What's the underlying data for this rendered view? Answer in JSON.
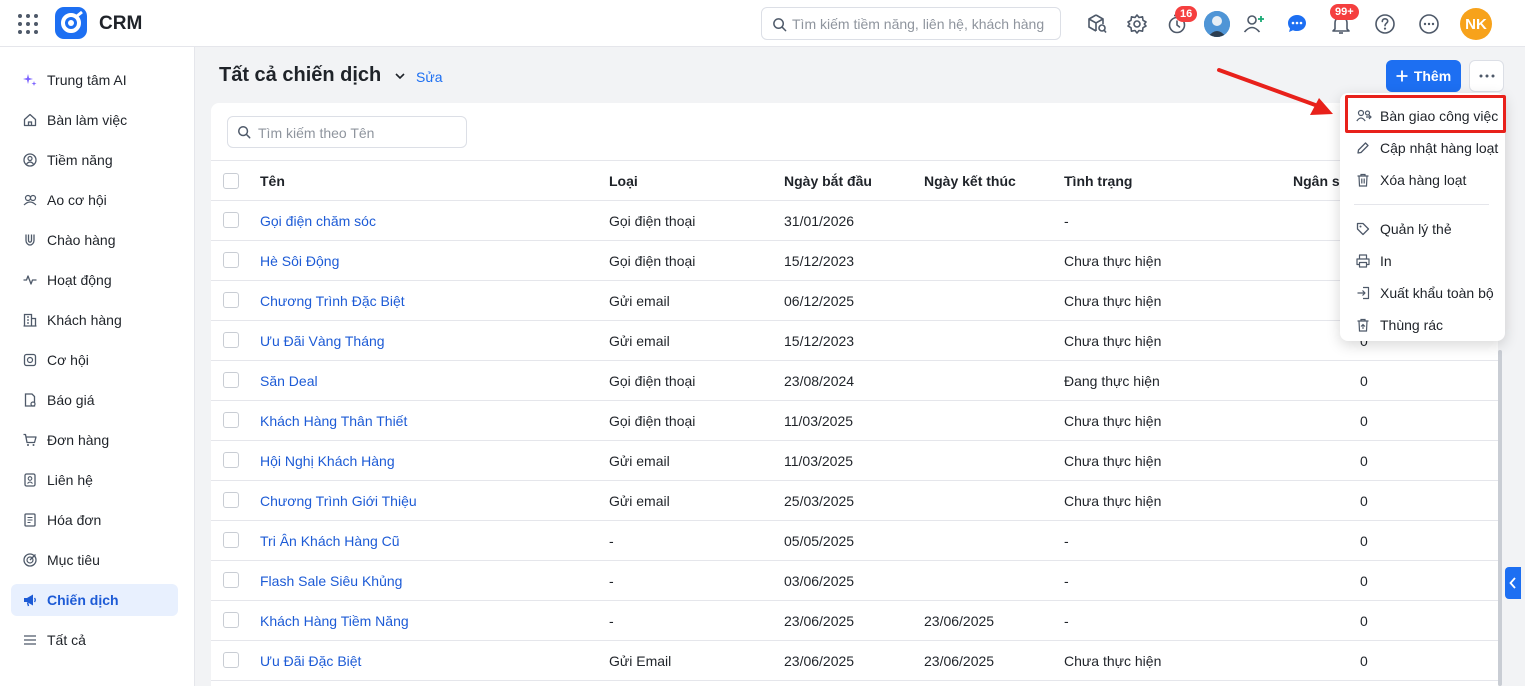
{
  "app": {
    "name": "CRM"
  },
  "header": {
    "search_placeholder": "Tìm kiếm tiềm năng, liên hệ, khách hàng",
    "timer_badge": "16",
    "notif_badge": "99+",
    "avatar_initials": "NK"
  },
  "sidebar": {
    "items": [
      {
        "label": "Trung tâm AI",
        "icon": "sparkle-icon"
      },
      {
        "label": "Bàn làm việc",
        "icon": "home-icon"
      },
      {
        "label": "Tiềm năng",
        "icon": "leads-icon"
      },
      {
        "label": "Ao cơ hội",
        "icon": "opportunity-pool-icon"
      },
      {
        "label": "Chào hàng",
        "icon": "magnet-icon"
      },
      {
        "label": "Hoạt động",
        "icon": "activity-icon"
      },
      {
        "label": "Khách hàng",
        "icon": "building-icon"
      },
      {
        "label": "Cơ hội",
        "icon": "coin-icon"
      },
      {
        "label": "Báo giá",
        "icon": "quote-icon"
      },
      {
        "label": "Đơn hàng",
        "icon": "cart-icon"
      },
      {
        "label": "Liên hệ",
        "icon": "contact-icon"
      },
      {
        "label": "Hóa đơn",
        "icon": "invoice-icon"
      },
      {
        "label": "Mục tiêu",
        "icon": "target-icon"
      },
      {
        "label": "Chiến dịch",
        "icon": "megaphone-icon"
      },
      {
        "label": "Tất cả",
        "icon": "menu-icon"
      }
    ],
    "active_index": 13
  },
  "page": {
    "title": "Tất cả chiến dịch",
    "edit_label": "Sửa",
    "add_label": "Thêm",
    "table_search_placeholder": "Tìm kiếm theo Tên"
  },
  "table": {
    "columns": [
      "Tên",
      "Loại",
      "Ngày bắt đầu",
      "Ngày kết thúc",
      "Tình trạng",
      "Ngân s"
    ],
    "rows": [
      [
        "Gọi điện chăm sóc",
        "Gọi điện thoại",
        "31/01/2026",
        "",
        "-",
        ""
      ],
      [
        "Hè Sôi Động",
        "Gọi điện thoại",
        "15/12/2023",
        "",
        "Chưa thực hiện",
        ""
      ],
      [
        "Chương Trình Đặc Biệt",
        "Gửi email",
        "06/12/2025",
        "",
        "Chưa thực hiện",
        ""
      ],
      [
        "Ưu Đãi Vàng Tháng",
        "Gửi email",
        "15/12/2023",
        "",
        "Chưa thực hiện",
        "0"
      ],
      [
        "Săn Deal",
        "Gọi điện thoại",
        "23/08/2024",
        "",
        "Đang thực hiện",
        "0"
      ],
      [
        "Khách Hàng Thân Thiết",
        "Gọi điện thoại",
        "11/03/2025",
        "",
        "Chưa thực hiện",
        "0"
      ],
      [
        "Hội Nghị Khách Hàng",
        "Gửi email",
        "11/03/2025",
        "",
        "Chưa thực hiện",
        "0"
      ],
      [
        "Chương Trình Giới Thiệu",
        "Gửi email",
        "25/03/2025",
        "",
        "Chưa thực hiện",
        "0"
      ],
      [
        "Tri Ân Khách Hàng Cũ",
        "-",
        "05/05/2025",
        "",
        "-",
        "0"
      ],
      [
        "Flash Sale Siêu Khủng",
        "-",
        "03/06/2025",
        "",
        "-",
        "0"
      ],
      [
        "Khách Hàng Tiềm Năng",
        "-",
        "23/06/2025",
        "23/06/2025",
        "-",
        "0"
      ],
      [
        "Ưu Đãi Đặc Biệt",
        "Gửi Email",
        "23/06/2025",
        "23/06/2025",
        "Chưa thực hiện",
        "0"
      ]
    ]
  },
  "menu": {
    "items": [
      {
        "label": "Bàn giao công việc",
        "icon": "handover-icon"
      },
      {
        "label": "Cập nhật hàng loạt",
        "icon": "pencil-icon"
      },
      {
        "label": "Xóa hàng loạt",
        "icon": "trash-icon"
      },
      {
        "label": "Quản lý thẻ",
        "icon": "tag-icon"
      },
      {
        "label": "In",
        "icon": "printer-icon"
      },
      {
        "label": "Xuất khẩu toàn bộ",
        "icon": "export-icon"
      },
      {
        "label": "Thùng rác",
        "icon": "recycle-bin-icon"
      }
    ]
  },
  "colors": {
    "accent": "#1d6ff2",
    "highlight": "#e8211b",
    "badge": "#f53f3f",
    "avatar": "#f7a21b"
  }
}
